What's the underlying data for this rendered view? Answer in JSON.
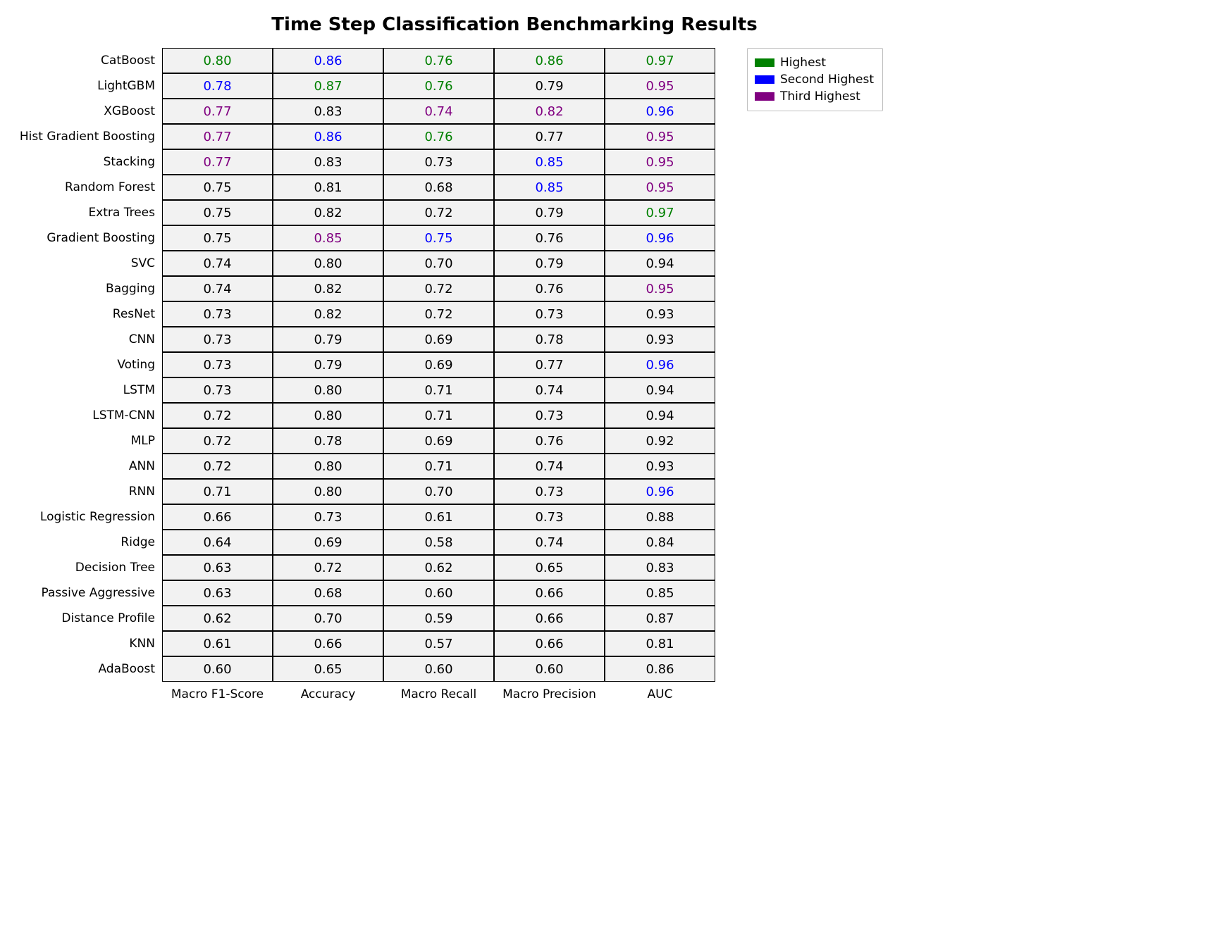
{
  "chart_data": {
    "type": "table",
    "title": "Time Step Classification Benchmarking Results",
    "columns": [
      "Macro F1-Score",
      "Accuracy",
      "Macro Recall",
      "Macro Precision",
      "AUC"
    ],
    "legend": {
      "items": [
        {
          "label": "Highest",
          "color": "#008000"
        },
        {
          "label": "Second Highest",
          "color": "#0000ff"
        },
        {
          "label": "Third Highest",
          "color": "#800080"
        }
      ]
    },
    "rows": [
      {
        "name": "CatBoost",
        "values": [
          "0.80",
          "0.86",
          "0.76",
          "0.86",
          "0.97"
        ],
        "ranks": [
          "green",
          "blue",
          "green",
          "green",
          "green"
        ]
      },
      {
        "name": "LightGBM",
        "values": [
          "0.78",
          "0.87",
          "0.76",
          "0.79",
          "0.95"
        ],
        "ranks": [
          "blue",
          "green",
          "green",
          "black",
          "purple"
        ]
      },
      {
        "name": "XGBoost",
        "values": [
          "0.77",
          "0.83",
          "0.74",
          "0.82",
          "0.96"
        ],
        "ranks": [
          "purple",
          "black",
          "purple",
          "purple",
          "blue"
        ]
      },
      {
        "name": "Hist Gradient Boosting",
        "values": [
          "0.77",
          "0.86",
          "0.76",
          "0.77",
          "0.95"
        ],
        "ranks": [
          "purple",
          "blue",
          "green",
          "black",
          "purple"
        ]
      },
      {
        "name": "Stacking",
        "values": [
          "0.77",
          "0.83",
          "0.73",
          "0.85",
          "0.95"
        ],
        "ranks": [
          "purple",
          "black",
          "black",
          "blue",
          "purple"
        ]
      },
      {
        "name": "Random Forest",
        "values": [
          "0.75",
          "0.81",
          "0.68",
          "0.85",
          "0.95"
        ],
        "ranks": [
          "black",
          "black",
          "black",
          "blue",
          "purple"
        ]
      },
      {
        "name": "Extra Trees",
        "values": [
          "0.75",
          "0.82",
          "0.72",
          "0.79",
          "0.97"
        ],
        "ranks": [
          "black",
          "black",
          "black",
          "black",
          "green"
        ]
      },
      {
        "name": "Gradient Boosting",
        "values": [
          "0.75",
          "0.85",
          "0.75",
          "0.76",
          "0.96"
        ],
        "ranks": [
          "black",
          "purple",
          "blue",
          "black",
          "blue"
        ]
      },
      {
        "name": "SVC",
        "values": [
          "0.74",
          "0.80",
          "0.70",
          "0.79",
          "0.94"
        ],
        "ranks": [
          "black",
          "black",
          "black",
          "black",
          "black"
        ]
      },
      {
        "name": "Bagging",
        "values": [
          "0.74",
          "0.82",
          "0.72",
          "0.76",
          "0.95"
        ],
        "ranks": [
          "black",
          "black",
          "black",
          "black",
          "purple"
        ]
      },
      {
        "name": "ResNet",
        "values": [
          "0.73",
          "0.82",
          "0.72",
          "0.73",
          "0.93"
        ],
        "ranks": [
          "black",
          "black",
          "black",
          "black",
          "black"
        ]
      },
      {
        "name": "CNN",
        "values": [
          "0.73",
          "0.79",
          "0.69",
          "0.78",
          "0.93"
        ],
        "ranks": [
          "black",
          "black",
          "black",
          "black",
          "black"
        ]
      },
      {
        "name": "Voting",
        "values": [
          "0.73",
          "0.79",
          "0.69",
          "0.77",
          "0.96"
        ],
        "ranks": [
          "black",
          "black",
          "black",
          "black",
          "blue"
        ]
      },
      {
        "name": "LSTM",
        "values": [
          "0.73",
          "0.80",
          "0.71",
          "0.74",
          "0.94"
        ],
        "ranks": [
          "black",
          "black",
          "black",
          "black",
          "black"
        ]
      },
      {
        "name": "LSTM-CNN",
        "values": [
          "0.72",
          "0.80",
          "0.71",
          "0.73",
          "0.94"
        ],
        "ranks": [
          "black",
          "black",
          "black",
          "black",
          "black"
        ]
      },
      {
        "name": "MLP",
        "values": [
          "0.72",
          "0.78",
          "0.69",
          "0.76",
          "0.92"
        ],
        "ranks": [
          "black",
          "black",
          "black",
          "black",
          "black"
        ]
      },
      {
        "name": "ANN",
        "values": [
          "0.72",
          "0.80",
          "0.71",
          "0.74",
          "0.93"
        ],
        "ranks": [
          "black",
          "black",
          "black",
          "black",
          "black"
        ]
      },
      {
        "name": "RNN",
        "values": [
          "0.71",
          "0.80",
          "0.70",
          "0.73",
          "0.96"
        ],
        "ranks": [
          "black",
          "black",
          "black",
          "black",
          "blue"
        ]
      },
      {
        "name": "Logistic Regression",
        "values": [
          "0.66",
          "0.73",
          "0.61",
          "0.73",
          "0.88"
        ],
        "ranks": [
          "black",
          "black",
          "black",
          "black",
          "black"
        ]
      },
      {
        "name": "Ridge",
        "values": [
          "0.64",
          "0.69",
          "0.58",
          "0.74",
          "0.84"
        ],
        "ranks": [
          "black",
          "black",
          "black",
          "black",
          "black"
        ]
      },
      {
        "name": "Decision Tree",
        "values": [
          "0.63",
          "0.72",
          "0.62",
          "0.65",
          "0.83"
        ],
        "ranks": [
          "black",
          "black",
          "black",
          "black",
          "black"
        ]
      },
      {
        "name": "Passive Aggressive",
        "values": [
          "0.63",
          "0.68",
          "0.60",
          "0.66",
          "0.85"
        ],
        "ranks": [
          "black",
          "black",
          "black",
          "black",
          "black"
        ]
      },
      {
        "name": "Distance Profile",
        "values": [
          "0.62",
          "0.70",
          "0.59",
          "0.66",
          "0.87"
        ],
        "ranks": [
          "black",
          "black",
          "black",
          "black",
          "black"
        ]
      },
      {
        "name": "KNN",
        "values": [
          "0.61",
          "0.66",
          "0.57",
          "0.66",
          "0.81"
        ],
        "ranks": [
          "black",
          "black",
          "black",
          "black",
          "black"
        ]
      },
      {
        "name": "AdaBoost",
        "values": [
          "0.60",
          "0.65",
          "0.60",
          "0.60",
          "0.86"
        ],
        "ranks": [
          "black",
          "black",
          "black",
          "black",
          "black"
        ]
      }
    ]
  }
}
